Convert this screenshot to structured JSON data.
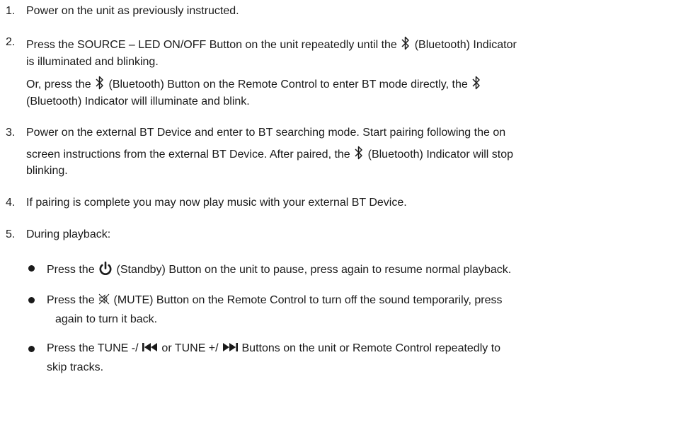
{
  "steps": [
    {
      "num": "1.",
      "text": "Power on the unit as previously instructed."
    },
    {
      "num": "2.",
      "line1_pre": "Press the SOURCE – LED ON/OFF Button on the unit repeatedly until the",
      "line1_post": "(Bluetooth) Indicator",
      "line2": "is illuminated and blinking.",
      "line3_pre": "Or, press the",
      "line3_post": "(Bluetooth) Button on the Remote Control to enter BT mode directly, the",
      "line4": "(Bluetooth) Indicator  will  illuminate and blink."
    },
    {
      "num": "3.",
      "line1": "Power on the external BT Device and enter to BT searching mode. Start pairing following the on",
      "line2_pre": "screen  instructions from the external BT Device. After paired, the",
      "line2_post": "(Bluetooth) Indicator will stop",
      "line3": "blinking."
    },
    {
      "num": "4.",
      "text": "If pairing is complete you may now play music with your external BT Device."
    },
    {
      "num": "5.",
      "text": "During playback:"
    }
  ],
  "bullets": [
    {
      "pre": "Press the",
      "post": "(Standby) Button on the unit to pause, press again to resume normal playback."
    },
    {
      "pre": "Press the",
      "post": "(MUTE) Button on the Remote Control to turn off the sound temporarily, press",
      "line2": "again to turn  it back."
    },
    {
      "pre": "Press the TUNE -/",
      "mid": "or  TUNE +/",
      "post": "Buttons on the unit or Remote Control repeatedly to",
      "line2": "skip tracks."
    }
  ],
  "icons": {
    "bluetooth": "bluetooth-icon",
    "standby": "power-icon",
    "mute": "mute-icon",
    "prev": "skip-back-icon",
    "next": "skip-forward-icon"
  }
}
